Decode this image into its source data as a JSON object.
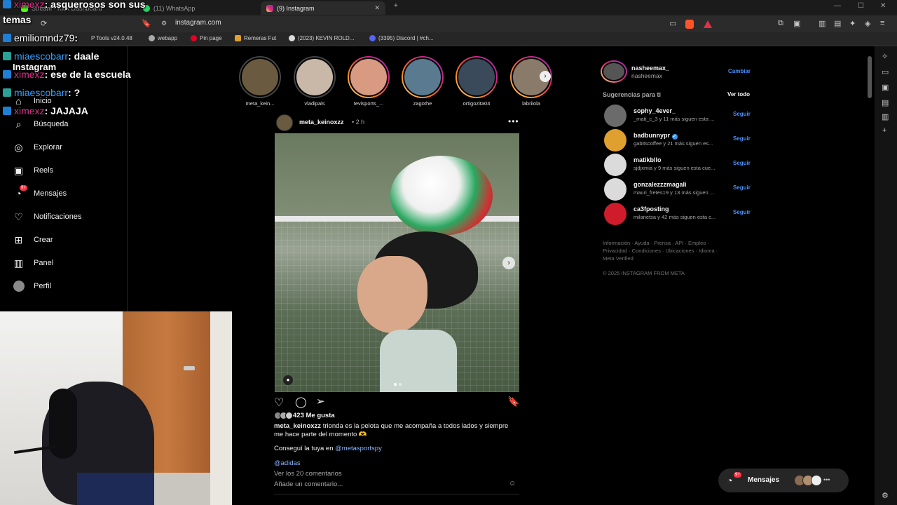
{
  "browser": {
    "tabs": [
      {
        "label": "Stream - Kick Dashboard"
      },
      {
        "label": "(11) WhatsApp"
      },
      {
        "label": "(9) Instagram"
      }
    ],
    "url": "instagram.com",
    "bookmarks": [
      "P  Tools v24.0.48",
      "webapp",
      "Pin page",
      "Remeras Fut",
      "(2023) KEVIN ROLD...",
      "(3395) Discord | #ch..."
    ]
  },
  "chat": [
    {
      "user": "ximexz",
      "msg": ": asquerosos son sus",
      "color": "#e0308a"
    },
    {
      "user": "",
      "msg": "temas",
      "color": "#fff"
    },
    {
      "user": "emiliomndz79",
      "msg": ":",
      "color": "#ffffff"
    },
    {
      "user": "miaescobarr",
      "msg": ": daale",
      "color": "#3aa0ff"
    },
    {
      "user": "",
      "msg": "Instagram",
      "color": "#fff"
    },
    {
      "user": "ximexz",
      "msg": ": ese de la escuela",
      "color": "#e0308a"
    },
    {
      "user": "miaescobarr",
      "msg": ": ?",
      "color": "#3aa0ff"
    },
    {
      "user": "ximexz",
      "msg": ": JAJAJA",
      "color": "#e0308a"
    }
  ],
  "sidebar": {
    "items": [
      {
        "label": "Inicio",
        "icon": "home-icon"
      },
      {
        "label": "Búsqueda",
        "icon": "search-icon"
      },
      {
        "label": "Explorar",
        "icon": "compass-icon"
      },
      {
        "label": "Reels",
        "icon": "reels-icon"
      },
      {
        "label": "Mensajes",
        "icon": "messenger-icon",
        "badge": "9+"
      },
      {
        "label": "Notificaciones",
        "icon": "heart-icon"
      },
      {
        "label": "Crear",
        "icon": "plus-square-icon"
      },
      {
        "label": "Panel",
        "icon": "chart-icon"
      },
      {
        "label": "Perfil",
        "icon": "avatar-icon"
      }
    ]
  },
  "stories": [
    {
      "name": "meta_kein...",
      "seen": true
    },
    {
      "name": "vladipals",
      "seen": true
    },
    {
      "name": "tevisports_...",
      "seen": false
    },
    {
      "name": "zagothe",
      "seen": false
    },
    {
      "name": "ortigozita04",
      "seen": false
    },
    {
      "name": "labriiola",
      "seen": false
    }
  ],
  "post": {
    "author": "meta_keinoxzz",
    "time": "• 2 h",
    "likes": "423 Me gusta",
    "caption_user": "meta_keinoxzz",
    "caption": "trionda es la pelota que me acompaña a todos lados y siempre me hace parte del momento 🫶",
    "cta_prefix": "Conseguí la tuya en",
    "cta_link": "@metasportspy",
    "tag": "@adidas",
    "comments": "Ver los 20 comentarios",
    "add_comment": "Añade un comentario..."
  },
  "account": {
    "username": "nasheemax_",
    "name": "nasheemax",
    "switch": "Cambiar"
  },
  "suggestions_title": "Sugerencias para ti",
  "see_all": "Ver todo",
  "suggestions": [
    {
      "name": "sophy_4ever_",
      "sub": "_mati_c_3 y 11 más siguen esta ...",
      "follow": "Seguir"
    },
    {
      "name": "badbunnypr",
      "sub": "gabitscoffee y 21 más siguen es...",
      "follow": "Seguir",
      "verified": true
    },
    {
      "name": "matikbllo",
      "sub": "sjdjxmia y 9 más siguen esta cue...",
      "follow": "Seguir"
    },
    {
      "name": "gonzalezzzmagali",
      "sub": "mauri_fretes19 y 13 más siguen ...",
      "follow": "Seguir"
    },
    {
      "name": "ca3fposting",
      "sub": "milanetsa y 42 más siguen esta c...",
      "follow": "Seguir"
    }
  ],
  "footer": {
    "line1": "Información · Ayuda · Prensa · API · Empleo ·",
    "line2": "Privacidad · Condiciones · Ubicaciones · Idioma ·",
    "line3": "Meta Verified",
    "copyright": "© 2025 INSTAGRAM FROM META"
  },
  "messages_pill": {
    "label": "Mensajes",
    "badge": "9+"
  },
  "colors": {
    "accent": "#4a90ff",
    "badge": "#ff3040",
    "story_ring": "#d62976"
  }
}
